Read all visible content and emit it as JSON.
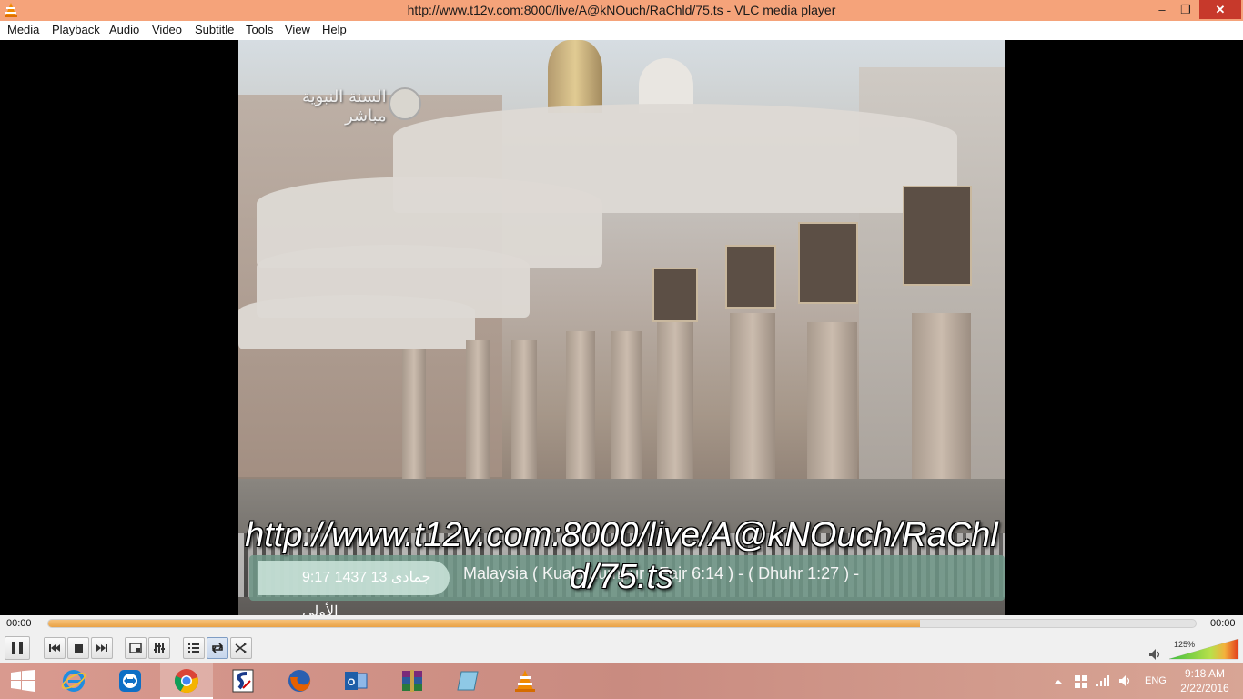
{
  "window": {
    "title": "http://www.t12v.com:8000/live/A@kNOuch/RaChld/75.ts - VLC media player",
    "controls": {
      "minimize": "‒",
      "maximize": "❐",
      "close": "✕"
    }
  },
  "menu": [
    "Media",
    "Playback",
    "Audio",
    "Video",
    "Subtitle",
    "Tools",
    "View",
    "Help"
  ],
  "video": {
    "osd_url": "http://www.t12v.com:8000/live/A@kNOuch/RaChld/75.ts",
    "channel_logo_text": "السنة النبوية\nمباشر",
    "ticker_clock": "9:17 1437 13 جمادى الأولى",
    "ticker_text": "Malaysia ( Kuala Lumpur ( Fajr 6:14 ) - ( Dhuhr 1:27 ) -"
  },
  "seek": {
    "elapsed": "00:00",
    "remaining": "00:00",
    "progress": 0.76
  },
  "controls": {
    "buttons": [
      "play-pause",
      "previous",
      "stop",
      "next",
      "fullscreen",
      "extended-settings",
      "playlist",
      "loop",
      "shuffle"
    ],
    "loop_active": true
  },
  "volume": {
    "level_label": "125%",
    "level": 1.25
  },
  "taskbar": {
    "apps": [
      "internet-explorer",
      "teamviewer",
      "chrome",
      "sumatra",
      "firefox",
      "outlook",
      "winrar",
      "notepad",
      "vlc"
    ],
    "active_app": "chrome",
    "language": "ENG",
    "time": "9:18 AM",
    "date": "2/22/2016"
  },
  "colors": {
    "titlebar": "#f5a37a",
    "close": "#c7392b",
    "seek_fill": "#e9a246",
    "taskbar": "#d09489"
  }
}
